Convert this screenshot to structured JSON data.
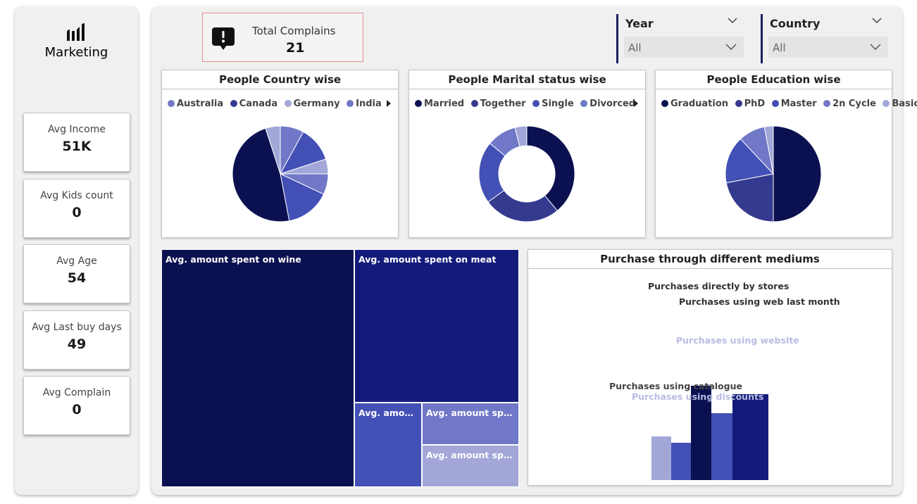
{
  "sidebar": {
    "title": "Marketing",
    "logo_icon": "bar-chart-icon",
    "kpis": [
      {
        "label": "Avg Income",
        "value": "51K"
      },
      {
        "label": "Avg Kids count",
        "value": "0"
      },
      {
        "label": "Avg Age",
        "value": "54"
      },
      {
        "label": "Avg Last buy days",
        "value": "49"
      },
      {
        "label": "Avg Complain",
        "value": "0"
      }
    ]
  },
  "header": {
    "complains": {
      "label": "Total Complains",
      "value": "21",
      "icon": "alert-speech-bubble-icon"
    },
    "slicers": [
      {
        "title": "Year",
        "value": "All"
      },
      {
        "title": "Country",
        "value": "All"
      }
    ]
  },
  "colors": {
    "navy": "#0b1150",
    "deep_blue": "#131b7a",
    "indigo": "#343a8e",
    "royal": "#4350b6",
    "periwinkle": "#7178c8",
    "lavender": "#a2a7d8",
    "accent_border": "#e88a8a"
  },
  "chart_data": [
    {
      "type": "pie",
      "title": "People Country wise",
      "legend_position": "top-left",
      "legend": [
        "Australia",
        "Canada",
        "Germany",
        "India"
      ],
      "slices": [
        {
          "value": 8,
          "color": "#7178c8"
        },
        {
          "value": 12,
          "color": "#4350b6"
        },
        {
          "value": 5,
          "color": "#a2a7d8"
        },
        {
          "value": 7,
          "color": "#7178c8"
        },
        {
          "value": 15,
          "color": "#4350b6"
        },
        {
          "value": 48,
          "color": "#0b1150"
        },
        {
          "value": 5,
          "color": "#a2a7d8"
        }
      ]
    },
    {
      "type": "pie",
      "donut": true,
      "title": "People Marital status wise",
      "legend_position": "top-left",
      "legend": [
        "Married",
        "Together",
        "Single",
        "Divorced"
      ],
      "slices": [
        {
          "label": "Married",
          "value": 39,
          "color": "#0b1150"
        },
        {
          "label": "Together",
          "value": 26,
          "color": "#343a8e"
        },
        {
          "label": "Single",
          "value": 21,
          "color": "#4350b6"
        },
        {
          "label": "Divorced",
          "value": 10,
          "color": "#7178c8"
        },
        {
          "value": 4,
          "color": "#a2a7d8"
        }
      ]
    },
    {
      "type": "pie",
      "title": "People Education wise",
      "legend_position": "top-left",
      "legend": [
        "Graduation",
        "PhD",
        "Master",
        "2n Cycle",
        "Basic"
      ],
      "slices": [
        {
          "label": "Graduation",
          "value": 50,
          "color": "#0b1150"
        },
        {
          "label": "PhD",
          "value": 22,
          "color": "#343a8e"
        },
        {
          "label": "Master",
          "value": 16,
          "color": "#4350b6"
        },
        {
          "label": "2n Cycle",
          "value": 9,
          "color": "#7178c8"
        },
        {
          "label": "Basic",
          "value": 3,
          "color": "#a2a7d8"
        }
      ]
    },
    {
      "type": "treemap",
      "items": [
        {
          "label": "Avg. amount spent on wine",
          "value": 306,
          "color": "#0b1150"
        },
        {
          "label": "Avg. amount spent on meat",
          "value": 167,
          "color": "#131b7a"
        },
        {
          "label": "Avg. amou...",
          "value": 44,
          "color": "#4350b6"
        },
        {
          "label": "Avg. amount spe...",
          "value": 27,
          "color": "#7178c8"
        },
        {
          "label": "Avg. amount spe...",
          "value": 27,
          "color": "#a2a7d8"
        }
      ]
    },
    {
      "type": "bar",
      "title": "Purchase through different mediums",
      "ylim": [
        0,
        13
      ],
      "bars": [
        {
          "label": "Purchases using catalogue",
          "value": 2.7,
          "color": "#a2a7d8",
          "label_color": "#444444"
        },
        {
          "label": "Purchases using discounts",
          "value": 2.3,
          "color": "#4350b6",
          "label_color": "#b9bce2"
        },
        {
          "label": "Purchases directly by stores",
          "value": 5.8,
          "color": "#0b1150",
          "label_color": "#333333"
        },
        {
          "label": "Purchases using website",
          "value": 4.1,
          "color": "#4350b6",
          "label_color": "#b9bce2"
        },
        {
          "label": "Purchases using web last month",
          "value": 5.3,
          "color": "#131b7a",
          "label_color": "#333333"
        }
      ]
    }
  ]
}
